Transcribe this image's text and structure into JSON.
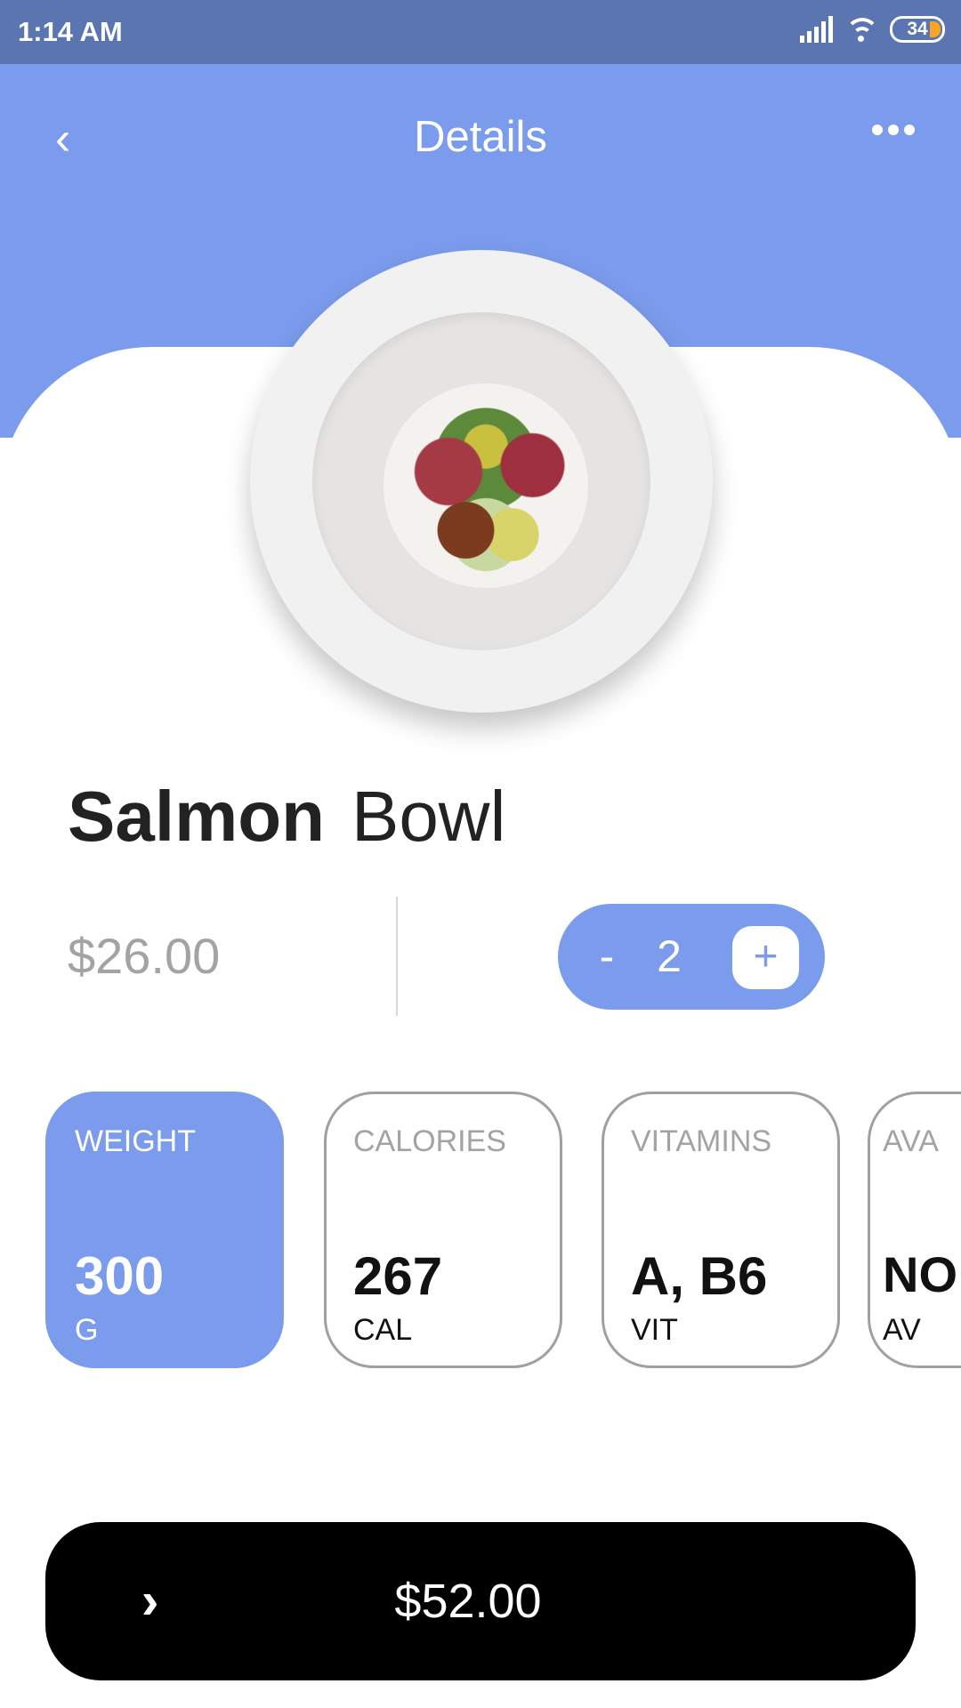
{
  "status_bar": {
    "time": "1:14 AM",
    "battery": "34"
  },
  "header": {
    "title": "Details",
    "back_icon": "chevron-left-icon",
    "menu_icon": "more-horizontal-icon"
  },
  "product": {
    "name_bold": "Salmon",
    "name_light": "Bowl",
    "price": "$26.00",
    "image": "salmon-bowl-plate"
  },
  "stepper": {
    "minus": "-",
    "quantity": "2",
    "plus": "+"
  },
  "cards": [
    {
      "label": "WEIGHT",
      "value": "300",
      "unit": "G",
      "active": true
    },
    {
      "label": "CALORIES",
      "value": "267",
      "unit": "CAL",
      "active": false
    },
    {
      "label": "VITAMINS",
      "value": "A, B6",
      "unit": "VIT",
      "active": false
    },
    {
      "label": "AVA",
      "value": "NO",
      "unit": "AV",
      "active": false
    }
  ],
  "checkout": {
    "arrows": ">>>>",
    "total": "$52.00"
  },
  "colors": {
    "accent": "#7b9bec",
    "status_bar": "#5b75b1",
    "button": "#000000"
  }
}
